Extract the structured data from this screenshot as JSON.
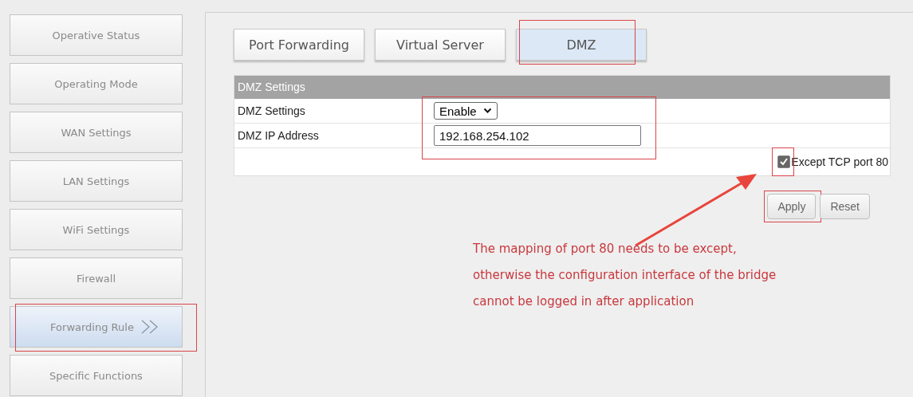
{
  "sidebar": {
    "items": [
      {
        "label": "Operative Status",
        "selected": false
      },
      {
        "label": "Operating Mode",
        "selected": false
      },
      {
        "label": "WAN Settings",
        "selected": false
      },
      {
        "label": "LAN Settings",
        "selected": false
      },
      {
        "label": "WiFi Settings",
        "selected": false
      },
      {
        "label": "Firewall",
        "selected": false
      },
      {
        "label": "Forwarding Rule",
        "selected": true
      },
      {
        "label": "Specific Functions",
        "selected": false
      }
    ]
  },
  "tabs": [
    {
      "label": "Port Forwarding",
      "selected": false
    },
    {
      "label": "Virtual Server",
      "selected": false
    },
    {
      "label": "DMZ",
      "selected": true
    }
  ],
  "settings_table": {
    "title": "DMZ Settings",
    "rows": [
      {
        "label": "DMZ Settings",
        "kind": "select",
        "value": "Enable"
      },
      {
        "label": "DMZ IP Address",
        "kind": "text",
        "value": "192.168.254.102"
      }
    ],
    "checkbox": {
      "label": "Except TCP port 80",
      "checked": true
    }
  },
  "buttons": [
    "Apply",
    "Reset"
  ],
  "annotation": {
    "lines": [
      "The mapping of port 80 needs to be except,",
      "otherwise the configuration interface of the bridge",
      "cannot be logged in after application"
    ]
  }
}
